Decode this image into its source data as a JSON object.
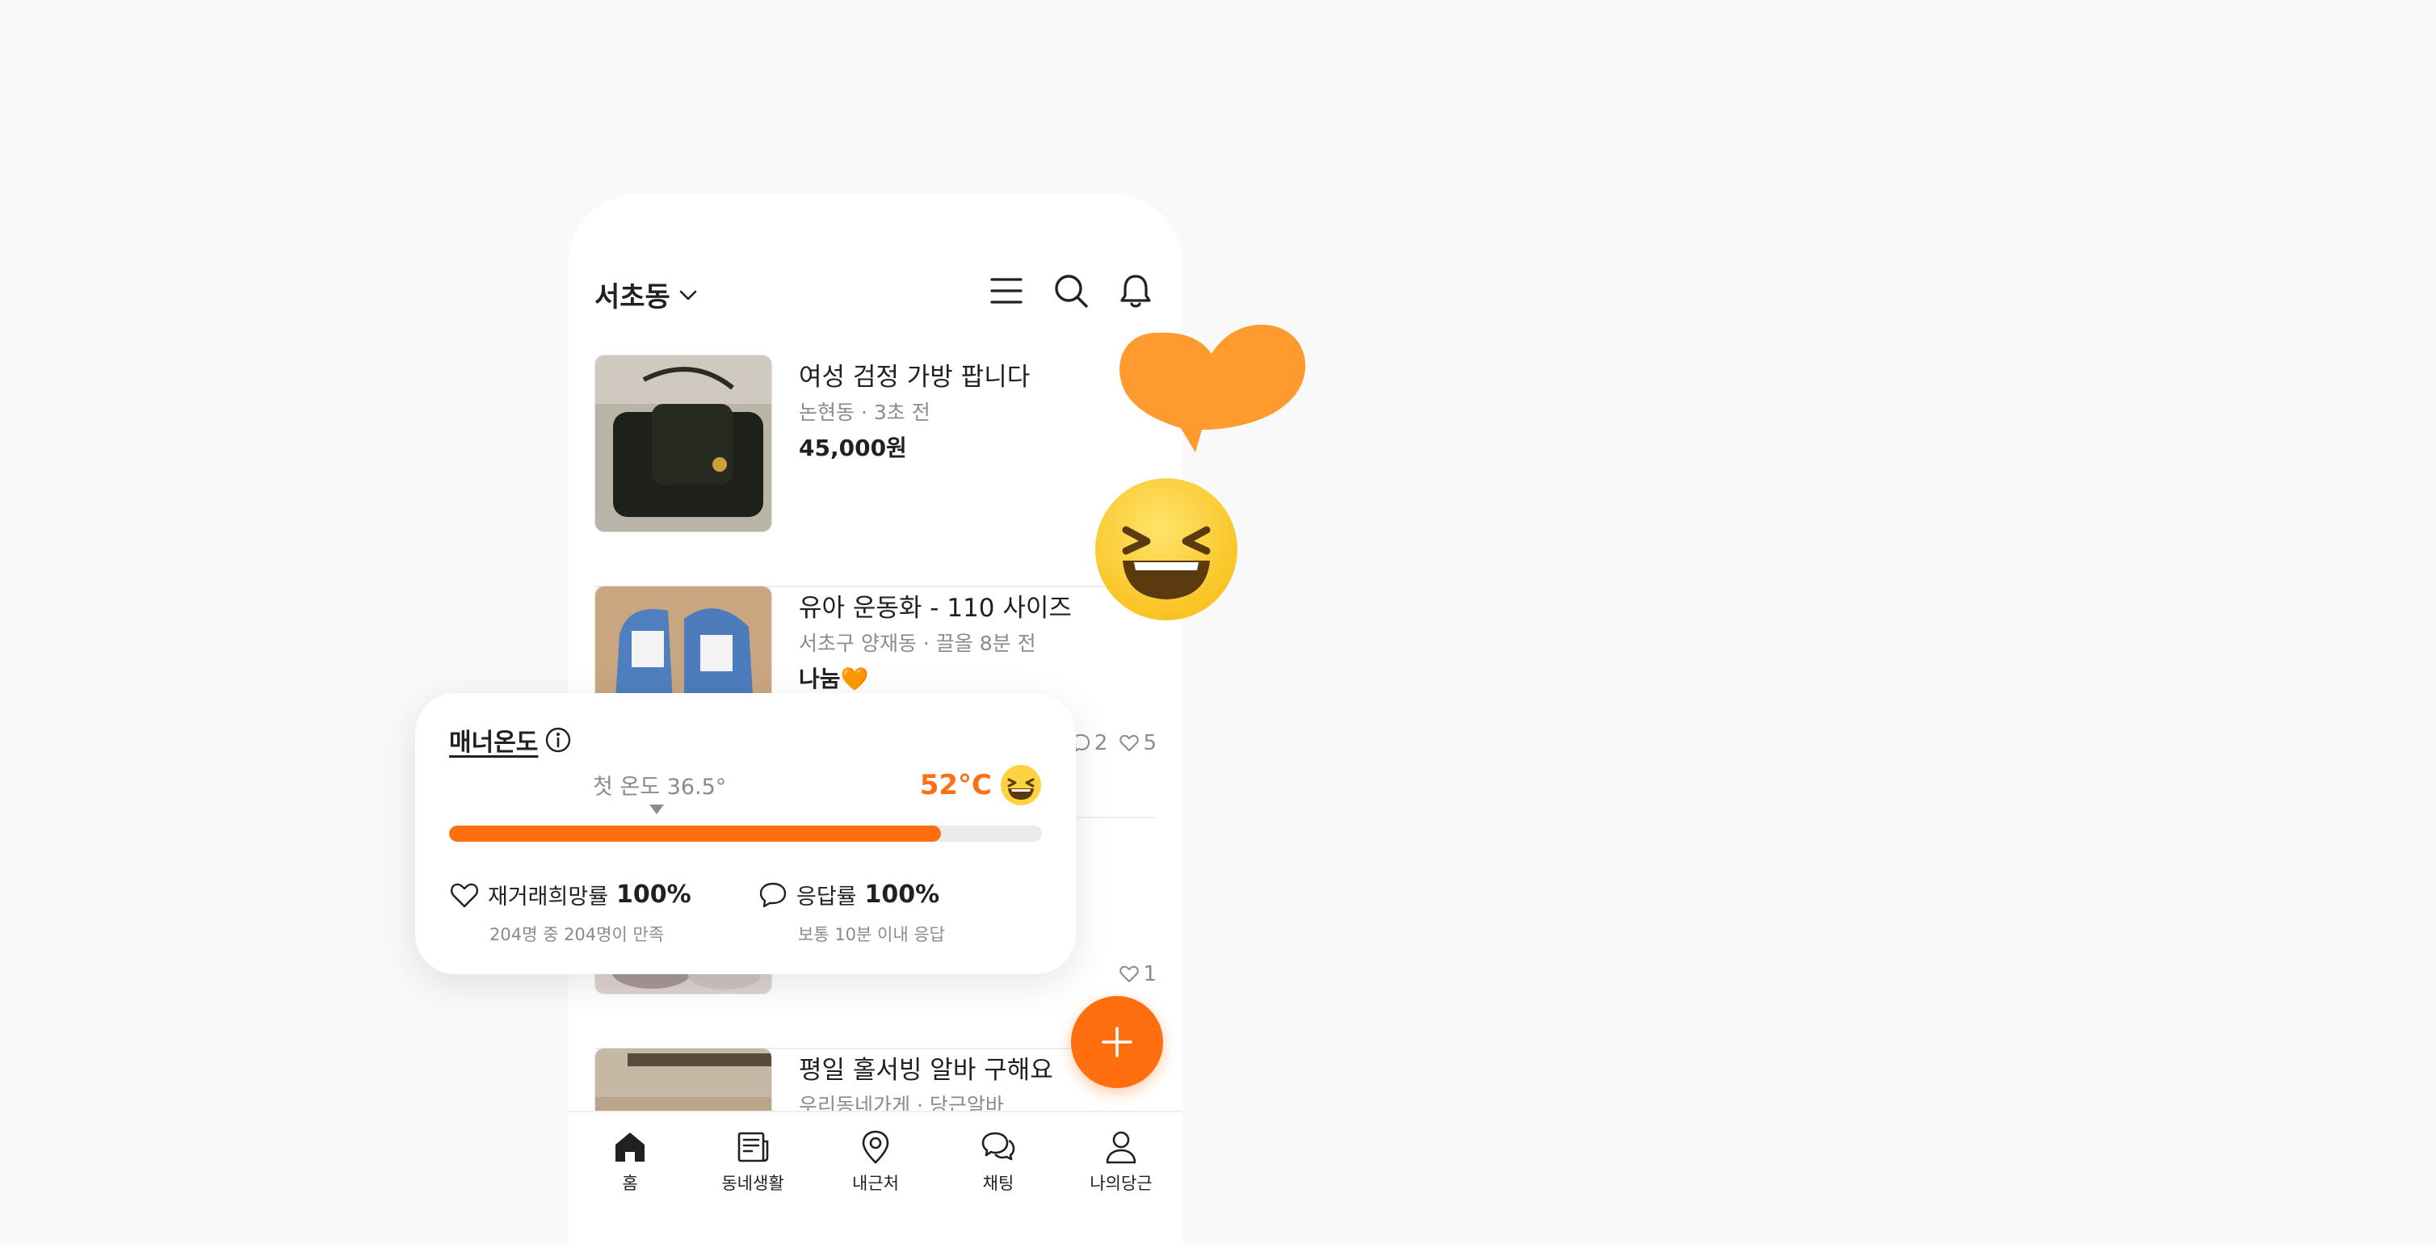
{
  "header": {
    "location": "서초동"
  },
  "listings": [
    {
      "title": "여성 검정 가방 팝니다",
      "meta": "논현동 · 3초 전",
      "price": "45,000원"
    },
    {
      "title": "유아 운동화 - 110 사이즈",
      "meta": "서초구 양재동 · 끌올 8분 전",
      "price": "나눔🧡",
      "chats": "2",
      "likes": "5"
    },
    {
      "likes": "1"
    },
    {
      "title": "평일 홀서빙 알바 구해요",
      "meta": "우리동네가게 · 당근알바"
    }
  ],
  "manner_card": {
    "title": "매너온도",
    "first_temp": "첫 온도 36.5°",
    "temperature": "52°C",
    "progress": 0.83,
    "stats": [
      {
        "label": "재거래희망률",
        "value": "100%",
        "sub": "204명 중 204명이 만족",
        "icon": "heart-icon"
      },
      {
        "label": "응답률",
        "value": "100%",
        "sub": "보통 10분 이내 응답",
        "icon": "chat-bubble-icon"
      }
    ]
  },
  "tabs": [
    {
      "label": "홈",
      "icon": "home-icon"
    },
    {
      "label": "동네생활",
      "icon": "news-icon"
    },
    {
      "label": "내근처",
      "icon": "location-pin-icon"
    },
    {
      "label": "채팅",
      "icon": "chat-icon"
    },
    {
      "label": "나의당근",
      "icon": "person-icon"
    }
  ],
  "colors": {
    "accent": "#ff6f0f",
    "text": "#212124",
    "subtext": "#868b94",
    "background": "#f9f9f9"
  }
}
